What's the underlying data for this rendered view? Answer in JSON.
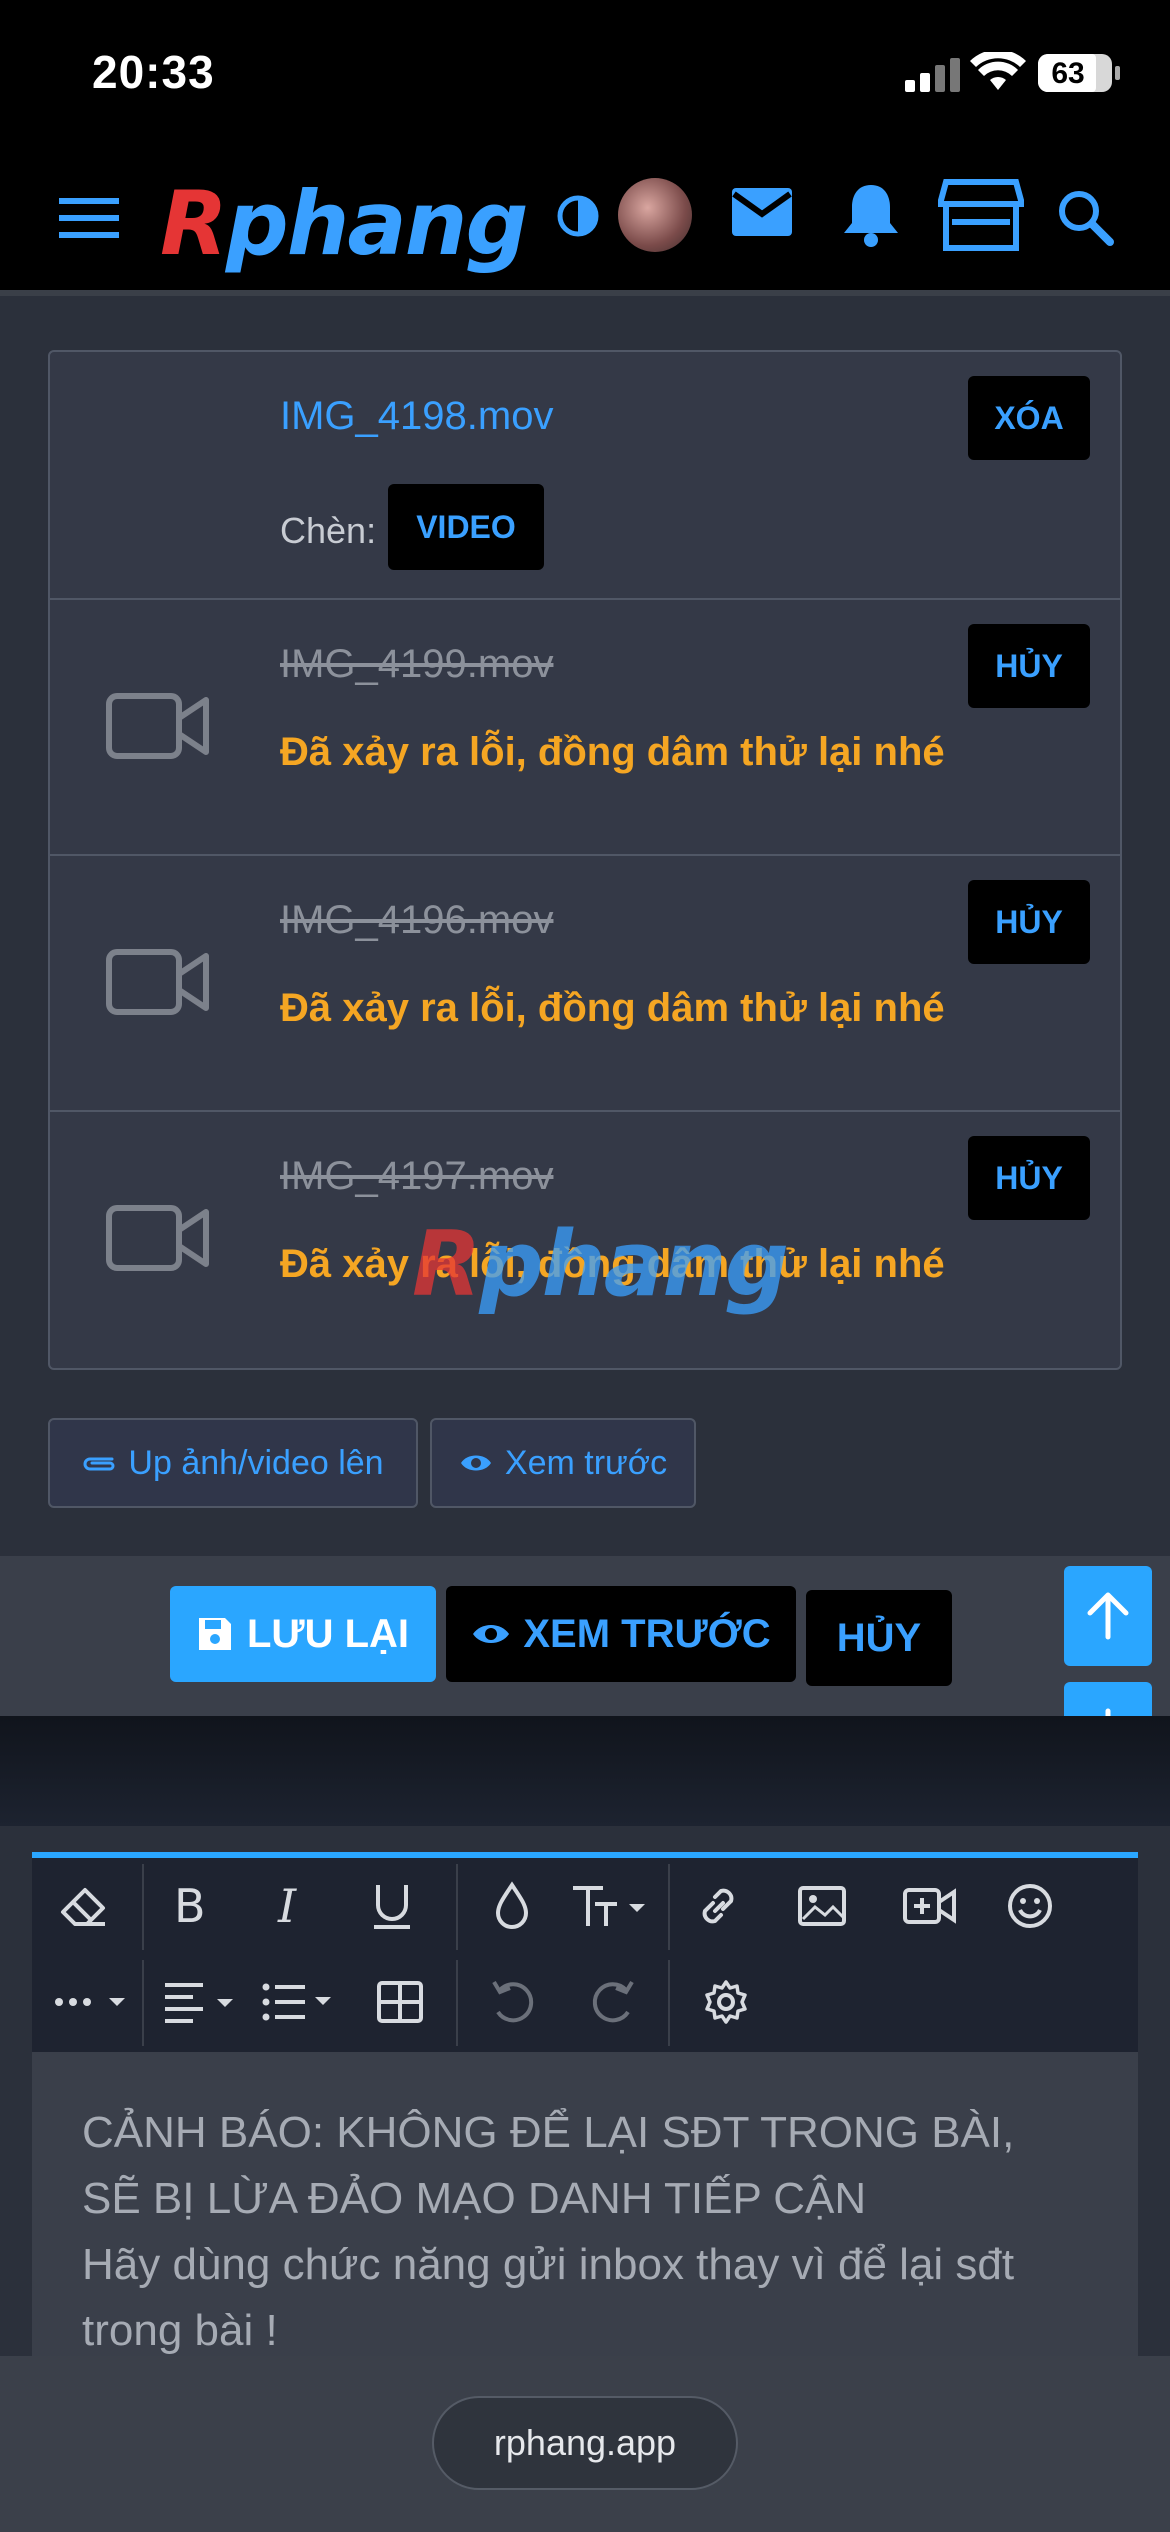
{
  "status": {
    "time": "20:33",
    "battery": "63"
  },
  "header": {
    "logo_first": "R",
    "logo_rest": "phang"
  },
  "attachments": [
    {
      "filename": "IMG_4198.mov",
      "insert_label": "Chèn:",
      "insert_button": "VIDEO",
      "action": "XÓA"
    },
    {
      "filename": "IMG_4199.mov",
      "error": "Đã xảy ra lỗi, đồng dâm thử lại nhé",
      "action": "HỦY"
    },
    {
      "filename": "IMG_4196.mov",
      "error": "Đã xảy ra lỗi, đồng dâm thử lại nhé",
      "action": "HỦY"
    },
    {
      "filename": "IMG_4197.mov",
      "error": "Đã xảy ra lỗi, đồng dâm thử lại nhé",
      "action": "HỦY"
    }
  ],
  "upload_button": "Up ảnh/video lên",
  "preview_small_button": "Xem trước",
  "actions": {
    "save": "LƯU LẠI",
    "preview": "XEM TRƯỚC",
    "cancel": "HỦY"
  },
  "editor": {
    "warning_line1": "CẢNH BÁO: KHÔNG ĐỂ LẠI SĐT TRONG BÀI,",
    "warning_line2": "SẼ BỊ LỪA ĐẢO MẠO DANH TIẾP CẬN",
    "warning_line3": "Hãy dùng chức năng gửi inbox thay vì để lại sđt",
    "warning_line4": "trong bài !"
  },
  "browser": {
    "url": "rphang.app"
  },
  "colors": {
    "accent": "#2aa6ff",
    "error": "#f5a623",
    "logo_red": "#e53535"
  }
}
